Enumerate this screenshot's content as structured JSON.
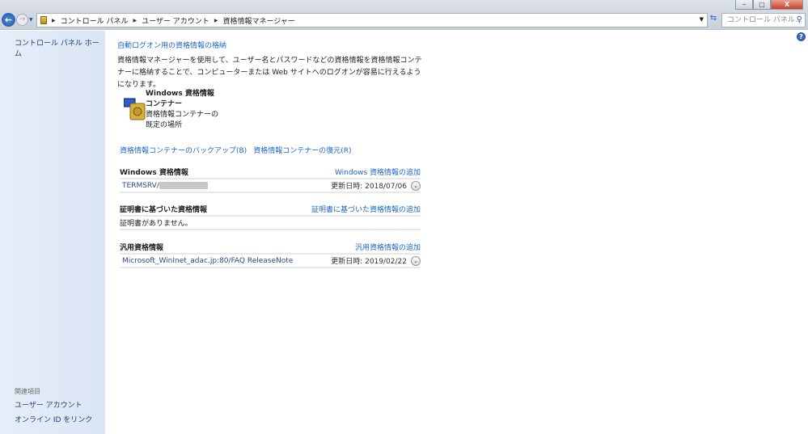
{
  "window": {
    "min": "‒",
    "max": "▢",
    "close": "X"
  },
  "address": {
    "crumbs": [
      "コントロール パネル",
      "ユーザー アカウント",
      "資格情報マネージャー"
    ],
    "search_placeholder": "コントロール パネル..."
  },
  "sidebar": {
    "home": "コントロール パネル ホーム",
    "related_heading": "関連項目",
    "links": [
      "ユーザー アカウント",
      "オンライン ID をリンク"
    ]
  },
  "main": {
    "title": "自動ログオン用の資格情報の格納",
    "description": "資格情報マネージャーを使用して、ユーザー名とパスワードなどの資格情報を資格情報コンテナーに格納することで、コンピューターまたは Web サイトへのログオンが容易に行えるようになります。",
    "vault": {
      "name_line1": "Windows 資格情報",
      "name_line2": "コンテナー",
      "desc_line1": "資格情報コンテナーの",
      "desc_line2": "既定の場所"
    },
    "backup": "資格情報コンテナーのバックアップ(B)",
    "restore": "資格情報コンテナーの復元(R)",
    "sections": [
      {
        "heading": "Windows 資格情報",
        "add": "Windows 資格情報の追加",
        "entry": "TERMSRV/",
        "updated": "更新日時:  2018/07/06"
      },
      {
        "heading": "証明書に基づいた資格情報",
        "add": "証明書に基づいた資格情報の追加",
        "empty": "証明書がありません。"
      },
      {
        "heading": "汎用資格情報",
        "add": "汎用資格情報の追加",
        "entry": "Microsoft_WinInet_adac.jp:80/FAQ ReleaseNote",
        "updated": "更新日時:  2019/02/22"
      }
    ]
  }
}
